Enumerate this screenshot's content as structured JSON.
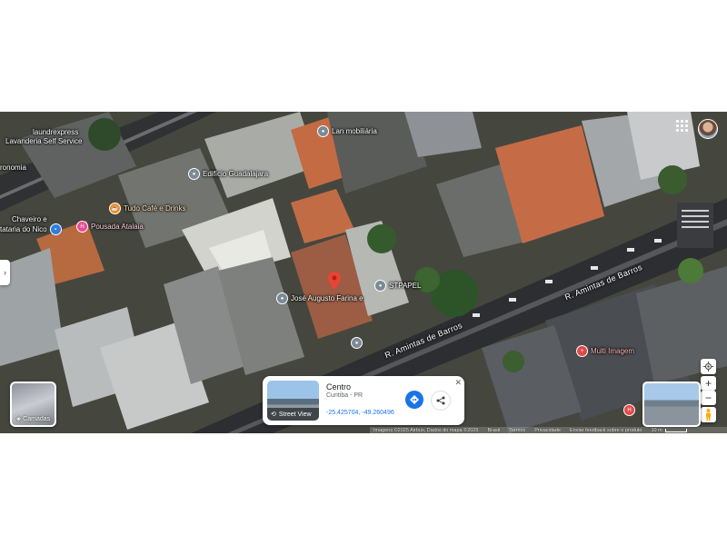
{
  "map": {
    "pois": [
      {
        "label": "laundrexpress",
        "icon": "none"
      },
      {
        "label": "Lavanderia Self Service",
        "icon": "none"
      },
      {
        "label": "ronomia",
        "icon": "none"
      },
      {
        "label": "Lan mobiliária",
        "icon": "furniture-store-icon"
      },
      {
        "label": "Edifício Guadalajara",
        "icon": "building-icon"
      },
      {
        "label": "Tudo Café e Drinks",
        "icon": "cafe-icon"
      },
      {
        "label": "Chaveiro e",
        "icon": "none"
      },
      {
        "label": "tataria do Nico",
        "icon": "shop-icon"
      },
      {
        "label": "Pousada Atalaia",
        "icon": "hotel-icon"
      },
      {
        "label": "José Augusto Farina e",
        "icon": "place-icon"
      },
      {
        "label": "STPAPEL",
        "icon": "place-icon"
      },
      {
        "label": "Multi Imagem",
        "icon": "medical-icon"
      }
    ],
    "streets": [
      {
        "label": "R. Amintas de Barros"
      },
      {
        "label": "R. Amintas de Barros"
      }
    ]
  },
  "header": {
    "apps_icon": "apps-grid-icon",
    "avatar_icon": "account-avatar-icon"
  },
  "layers_button": {
    "label": "Camadas"
  },
  "place_card": {
    "title": "Centro",
    "subtitle": "Curitiba - PR",
    "coordinates": "-25.425704, -49.260496",
    "street_view_label": "Street View",
    "close_icon": "close-icon",
    "directions_icon": "directions-icon",
    "share_icon": "share-icon"
  },
  "controls": {
    "zoom_in": "+",
    "zoom_out": "−",
    "location_icon": "my-location-icon",
    "pegman_icon": "pegman-icon"
  },
  "footer": {
    "imagery": "Imagens ©2025 Airbus, Dados do mapa ©2025",
    "country": "Brasil",
    "terms": "Termos",
    "privacy": "Privacidade",
    "feedback": "Enviar feedback sobre o produto",
    "scale": "10 m"
  },
  "colors": {
    "pin": "#ea4335",
    "link": "#1a73e8",
    "background": "#ffffff"
  }
}
